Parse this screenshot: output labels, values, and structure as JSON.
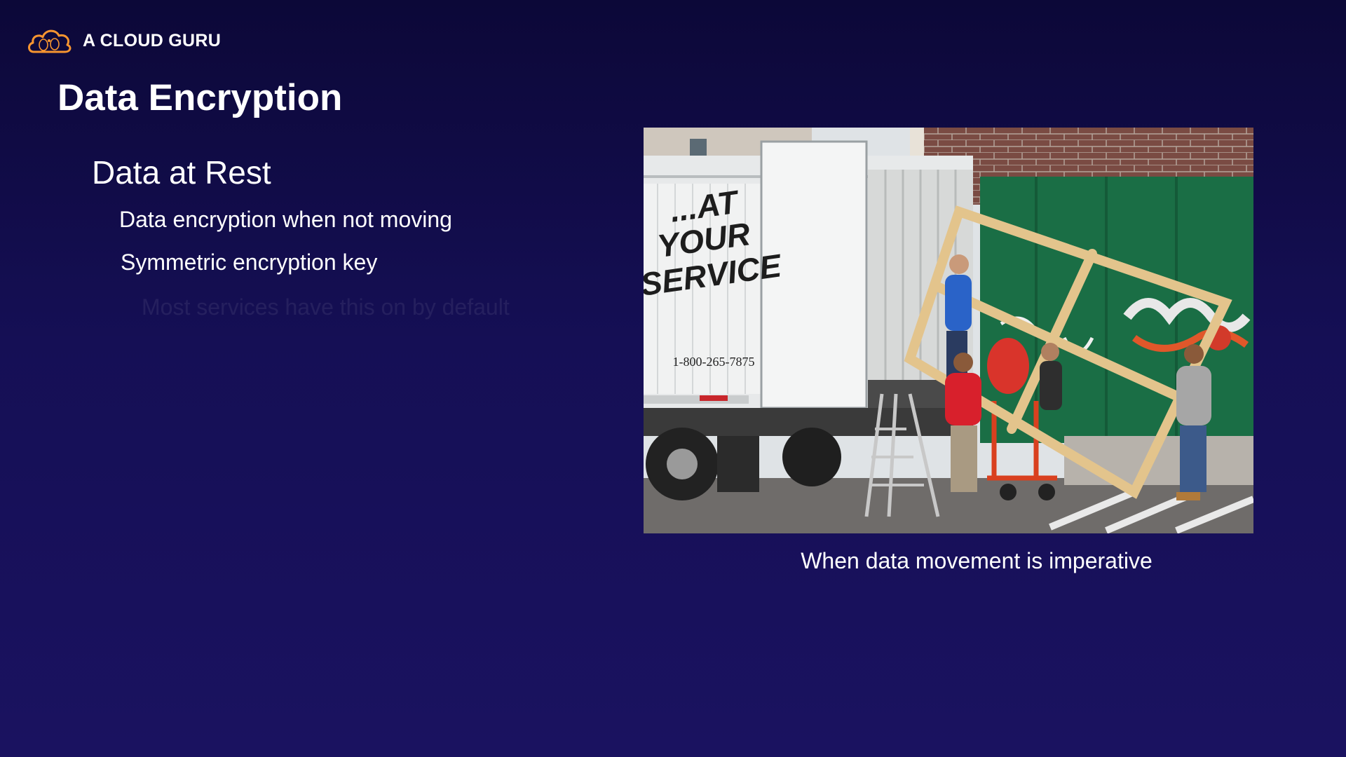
{
  "brand": {
    "name": "A CLOUD GURU",
    "icon": "cloud-logo-icon",
    "accent_color": "#f79530"
  },
  "slide": {
    "title": "Data Encryption",
    "section_heading": "Data at Rest",
    "bullets": [
      "Data encryption when not moving",
      "Symmetric encryption key",
      "Most services have this on by default"
    ],
    "photo": {
      "truck_sign": [
        "...AT",
        "YOUR",
        "SERVICE"
      ],
      "truck_phone": "1-800-265-7875"
    },
    "caption": "When data movement is imperative"
  }
}
